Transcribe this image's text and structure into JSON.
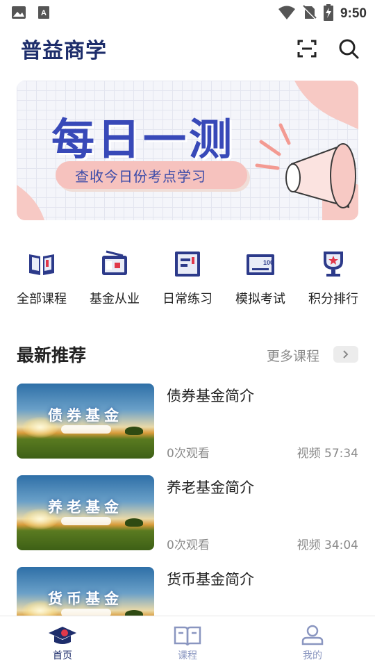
{
  "status_bar": {
    "time": "9:50",
    "icons": [
      "image-icon",
      "text-a-icon",
      "wifi-icon",
      "no-sim-icon",
      "battery-charging-icon"
    ]
  },
  "header": {
    "title": "普益商学",
    "actions": [
      "scan-icon",
      "search-icon"
    ]
  },
  "banner": {
    "title": "每日一测",
    "subtitle": "查收今日份考点学习",
    "accent_color": "#3849b8",
    "pill_color": "#f6c2be"
  },
  "categories": [
    {
      "label": "全部课程",
      "icon": "open-book-icon"
    },
    {
      "label": "基金从业",
      "icon": "radio-box-icon"
    },
    {
      "label": "日常练习",
      "icon": "exercise-card-icon"
    },
    {
      "label": "模拟考试",
      "icon": "exam-score-icon"
    },
    {
      "label": "积分排行",
      "icon": "trophy-icon"
    }
  ],
  "recommend": {
    "title": "最新推荐",
    "more_label": "更多课程"
  },
  "courses": [
    {
      "title": "债券基金简介",
      "thumb_title": "债券基金",
      "views": "0次观看",
      "meta": "视频 57:34"
    },
    {
      "title": "养老基金简介",
      "thumb_title": "养老基金",
      "views": "0次观看",
      "meta": "视频 34:04"
    },
    {
      "title": "货币基金简介",
      "thumb_title": "货币基金",
      "views": "",
      "meta": ""
    }
  ],
  "bottom_nav": [
    {
      "label": "首页",
      "icon": "home-cap-icon",
      "active": true
    },
    {
      "label": "课程",
      "icon": "book-icon",
      "active": false
    },
    {
      "label": "我的",
      "icon": "user-icon",
      "active": false
    }
  ],
  "colors": {
    "brand": "#1d2d6b",
    "nav_inactive": "#8a96c0",
    "accent_red": "#e0384a",
    "muted_text": "#8a8a8a"
  }
}
